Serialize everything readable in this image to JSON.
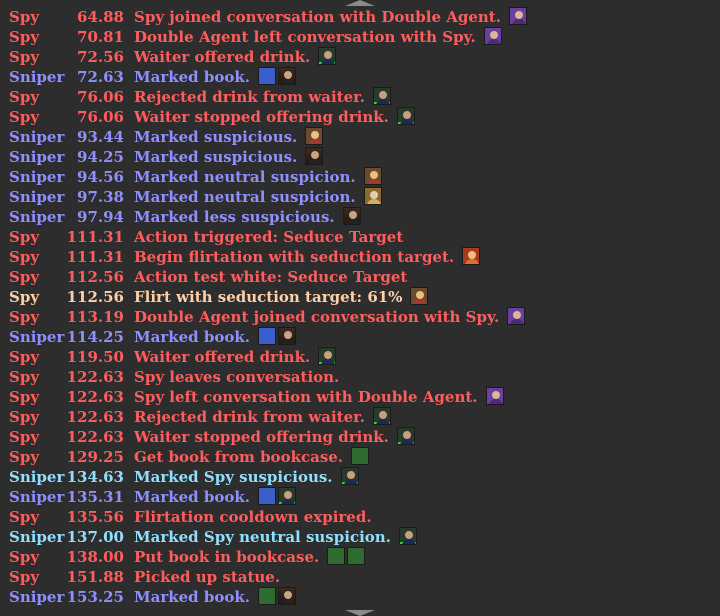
{
  "colors": {
    "spy": "#ff5d5d",
    "sniper": "#8f8fff",
    "sniper_spy_marked": "#8fdfff",
    "spy_flirt": "#ffd0a8",
    "background": "#2d2d2d"
  },
  "log": [
    {
      "role": "Spy",
      "time": "64.88",
      "text": "Spy joined conversation with Double Agent.",
      "style": "spy",
      "icons": [
        "purple-agent-portrait"
      ]
    },
    {
      "role": "Spy",
      "time": "70.81",
      "text": "Double Agent left conversation with Spy.",
      "style": "spy",
      "icons": [
        "purple-agent-portrait"
      ]
    },
    {
      "role": "Spy",
      "time": "72.56",
      "text": "Waiter offered drink.",
      "style": "spy",
      "icons": [
        "waiter-portrait"
      ]
    },
    {
      "role": "Sniper",
      "time": "72.63",
      "text": "Marked book.",
      "style": "sniper",
      "icons": [
        "blue-book-tile",
        "guest-portrait"
      ]
    },
    {
      "role": "Spy",
      "time": "76.06",
      "text": "Rejected drink from waiter.",
      "style": "spy",
      "icons": [
        "waiter-portrait"
      ]
    },
    {
      "role": "Spy",
      "time": "76.06",
      "text": "Waiter stopped offering drink.",
      "style": "spy",
      "icons": [
        "waiter-portrait"
      ]
    },
    {
      "role": "Sniper",
      "time": "93.44",
      "text": "Marked suspicious.",
      "style": "sniper",
      "icons": [
        "blonde-guest-portrait"
      ]
    },
    {
      "role": "Sniper",
      "time": "94.25",
      "text": "Marked suspicious.",
      "style": "sniper",
      "icons": [
        "guest-portrait"
      ]
    },
    {
      "role": "Sniper",
      "time": "94.56",
      "text": "Marked neutral suspicion.",
      "style": "sniper",
      "icons": [
        "blonde-guest-portrait"
      ]
    },
    {
      "role": "Sniper",
      "time": "97.38",
      "text": "Marked neutral suspicion.",
      "style": "sniper",
      "icons": [
        "gold-guest-portrait"
      ]
    },
    {
      "role": "Sniper",
      "time": "97.94",
      "text": "Marked less suspicious.",
      "style": "sniper",
      "icons": [
        "guest-portrait"
      ]
    },
    {
      "role": "Spy",
      "time": "111.31",
      "text": "Action triggered: Seduce Target",
      "style": "spy",
      "icons": []
    },
    {
      "role": "Spy",
      "time": "111.31",
      "text": "Begin flirtation with seduction target.",
      "style": "spy",
      "icons": [
        "orange-target-portrait"
      ]
    },
    {
      "role": "Spy",
      "time": "112.56",
      "text": "Action test white: Seduce Target",
      "style": "spy",
      "icons": []
    },
    {
      "role": "Spy",
      "time": "112.56",
      "text": "Flirt with seduction target: 61%",
      "style": "flirt",
      "icons": [
        "blonde-target-portrait"
      ]
    },
    {
      "role": "Spy",
      "time": "113.19",
      "text": "Double Agent joined conversation with Spy.",
      "style": "spy",
      "icons": [
        "purple-agent-portrait"
      ]
    },
    {
      "role": "Sniper",
      "time": "114.25",
      "text": "Marked book.",
      "style": "sniper",
      "icons": [
        "blue-book-tile",
        "guest-portrait"
      ]
    },
    {
      "role": "Spy",
      "time": "119.50",
      "text": "Waiter offered drink.",
      "style": "spy",
      "icons": [
        "waiter-portrait"
      ]
    },
    {
      "role": "Spy",
      "time": "122.63",
      "text": "Spy leaves conversation.",
      "style": "spy",
      "icons": []
    },
    {
      "role": "Spy",
      "time": "122.63",
      "text": "Spy left conversation with Double Agent.",
      "style": "spy",
      "icons": [
        "purple-agent-portrait"
      ]
    },
    {
      "role": "Spy",
      "time": "122.63",
      "text": "Rejected drink from waiter.",
      "style": "spy",
      "icons": [
        "waiter-portrait"
      ]
    },
    {
      "role": "Spy",
      "time": "122.63",
      "text": "Waiter stopped offering drink.",
      "style": "spy",
      "icons": [
        "waiter-portrait"
      ]
    },
    {
      "role": "Spy",
      "time": "129.25",
      "text": "Get book from bookcase.",
      "style": "spy",
      "icons": [
        "green-book-tile"
      ]
    },
    {
      "role": "Sniper",
      "time": "134.63",
      "text": "Marked Spy suspicious.",
      "style": "sniper_spy",
      "icons": [
        "waiter-portrait"
      ]
    },
    {
      "role": "Sniper",
      "time": "135.31",
      "text": "Marked book.",
      "style": "sniper",
      "icons": [
        "blue-book-tile",
        "waiter-portrait"
      ]
    },
    {
      "role": "Spy",
      "time": "135.56",
      "text": "Flirtation cooldown expired.",
      "style": "spy",
      "icons": []
    },
    {
      "role": "Sniper",
      "time": "137.00",
      "text": "Marked Spy neutral suspicion.",
      "style": "sniper_spy",
      "icons": [
        "waiter-portrait"
      ]
    },
    {
      "role": "Spy",
      "time": "138.00",
      "text": "Put book in bookcase.",
      "style": "spy",
      "icons": [
        "green-book-tile",
        "green-book-tile"
      ]
    },
    {
      "role": "Spy",
      "time": "151.88",
      "text": "Picked up statue.",
      "style": "spy",
      "icons": []
    },
    {
      "role": "Sniper",
      "time": "153.25",
      "text": "Marked book.",
      "style": "sniper",
      "icons": [
        "green-book-tile",
        "guest-portrait"
      ]
    }
  ]
}
